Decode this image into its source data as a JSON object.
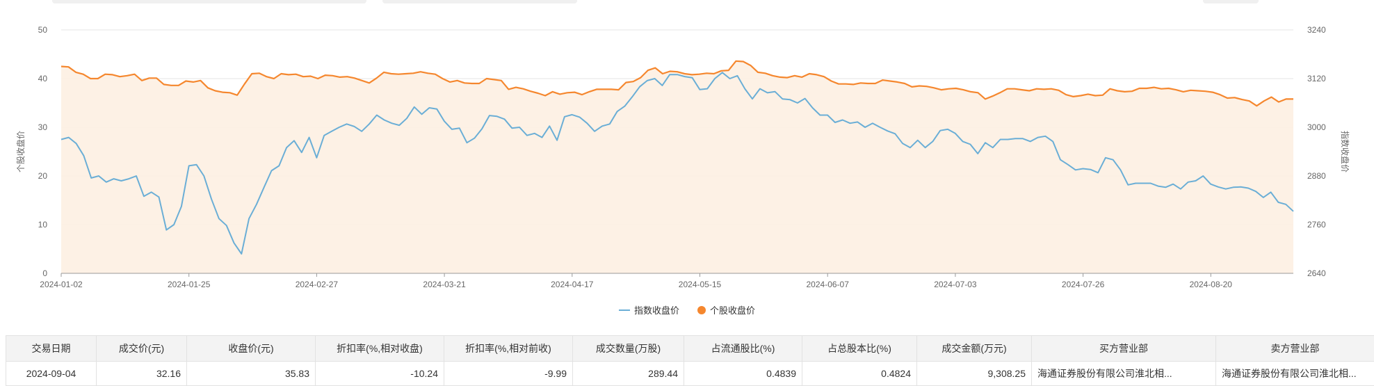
{
  "chart_data": {
    "type": "line",
    "x_tick_labels": [
      "2024-01-02",
      "2024-01-25",
      "2024-02-27",
      "2024-03-21",
      "2024-04-17",
      "2024-05-15",
      "2024-06-07",
      "2024-07-03",
      "2024-07-26",
      "2024-08-20"
    ],
    "left_axis": {
      "label": "个股收盘价",
      "ticks": [
        0,
        10,
        20,
        30,
        40,
        50
      ],
      "ylim": [
        0,
        50
      ]
    },
    "right_axis": {
      "label": "指数收盘价",
      "ticks": [
        2640,
        2760,
        2880,
        3000,
        3120,
        3240
      ],
      "ylim": [
        2640,
        3240
      ]
    },
    "grid": true,
    "legend_position": "bottom-center",
    "series": [
      {
        "name": "指数收盘价",
        "axis": "right",
        "color": "#6aaed6",
        "values": [
          2970,
          2975,
          2960,
          2930,
          2875,
          2880,
          2865,
          2873,
          2868,
          2873,
          2880,
          2830,
          2840,
          2828,
          2747,
          2760,
          2805,
          2905,
          2908,
          2880,
          2823,
          2775,
          2758,
          2715,
          2688,
          2775,
          2810,
          2852,
          2893,
          2905,
          2950,
          2967,
          2938,
          2975,
          2925,
          2980,
          2990,
          3000,
          3008,
          3002,
          2990,
          3008,
          3030,
          3018,
          3010,
          3005,
          3022,
          3050,
          3032,
          3048,
          3045,
          3015,
          2995,
          2998,
          2962,
          2973,
          2996,
          3029,
          3027,
          3020,
          2998,
          3000,
          2980,
          2985,
          2975,
          3003,
          2968,
          3026,
          3031,
          3025,
          3010,
          2990,
          3003,
          3008,
          3039,
          3052,
          3075,
          3100,
          3115,
          3120,
          3103,
          3130,
          3130,
          3125,
          3122,
          3093,
          3095,
          3120,
          3135,
          3120,
          3127,
          3095,
          3070,
          3095,
          3085,
          3088,
          3070,
          3068,
          3060,
          3071,
          3048,
          3030,
          3030,
          3012,
          3018,
          3010,
          3013,
          3000,
          3010,
          3000,
          2991,
          2984,
          2960,
          2950,
          2968,
          2950,
          2965,
          2992,
          2995,
          2985,
          2965,
          2958,
          2935,
          2962,
          2950,
          2970,
          2970,
          2972,
          2972,
          2965,
          2975,
          2978,
          2965,
          2920,
          2908,
          2895,
          2898,
          2896,
          2888,
          2925,
          2920,
          2895,
          2858,
          2862,
          2862,
          2862,
          2855,
          2852,
          2860,
          2848,
          2865,
          2868,
          2880,
          2860,
          2853,
          2848,
          2852,
          2853,
          2850,
          2842,
          2827,
          2840,
          2815,
          2810,
          2793
        ]
      },
      {
        "name": "个股收盘价",
        "axis": "left",
        "color": "#f5872e",
        "values": [
          42.5,
          42.4,
          41.3,
          40.9,
          40.0,
          40.0,
          40.9,
          40.8,
          40.4,
          40.6,
          40.9,
          39.6,
          40.1,
          40.1,
          38.8,
          38.6,
          38.6,
          39.5,
          39.3,
          39.6,
          38.1,
          37.5,
          37.2,
          37.1,
          36.6,
          38.9,
          41.0,
          41.1,
          40.4,
          40.0,
          41.0,
          40.8,
          40.9,
          40.4,
          40.5,
          40.0,
          40.7,
          40.6,
          40.3,
          40.4,
          40.1,
          39.6,
          39.1,
          40.1,
          41.3,
          41.0,
          40.9,
          41.0,
          41.1,
          41.4,
          41.1,
          40.9,
          40.0,
          39.3,
          39.6,
          39.1,
          39.0,
          39.0,
          40.0,
          39.8,
          39.6,
          37.8,
          38.2,
          37.9,
          37.4,
          37.0,
          36.5,
          37.3,
          36.8,
          37.1,
          37.2,
          36.7,
          37.3,
          37.8,
          37.8,
          37.8,
          37.7,
          39.2,
          39.4,
          40.2,
          41.7,
          42.2,
          41.0,
          41.5,
          41.4,
          41.0,
          40.8,
          40.9,
          41.1,
          41.0,
          41.6,
          41.7,
          43.6,
          43.5,
          42.7,
          41.3,
          41.1,
          40.6,
          40.3,
          40.2,
          40.6,
          40.3,
          41.0,
          40.8,
          40.4,
          39.5,
          38.9,
          38.9,
          38.8,
          39.1,
          39.0,
          39.0,
          39.7,
          39.5,
          39.3,
          39.0,
          38.3,
          38.5,
          38.4,
          38.1,
          37.7,
          37.9,
          38.0,
          37.7,
          37.3,
          37.1,
          35.8,
          36.4,
          37.1,
          37.9,
          37.9,
          37.7,
          37.5,
          37.9,
          37.8,
          37.9,
          37.6,
          36.7,
          36.3,
          36.5,
          36.8,
          36.5,
          36.6,
          37.9,
          37.5,
          37.3,
          37.4,
          38.0,
          38.0,
          38.2,
          37.9,
          38.0,
          37.7,
          37.3,
          37.6,
          37.5,
          37.4,
          37.2,
          36.7,
          36.0,
          36.1,
          35.7,
          35.4,
          34.4,
          35.4,
          36.2,
          35.2,
          35.8,
          35.8
        ]
      }
    ]
  },
  "table": {
    "headers": [
      "交易日期",
      "成交价(元)",
      "收盘价(元)",
      "折扣率(%,相对收盘)",
      "折扣率(%,相对前收)",
      "成交数量(万股)",
      "占流通股比(%)",
      "占总股本比(%)",
      "成交金额(万元)",
      "买方营业部",
      "卖方营业部"
    ],
    "row": [
      "2024-09-04",
      "32.16",
      "35.83",
      "-10.24",
      "-9.99",
      "289.44",
      "0.4839",
      "0.4824",
      "9,308.25",
      "海通证券股份有限公司淮北相...",
      "海通证券股份有限公司淮北相..."
    ]
  }
}
